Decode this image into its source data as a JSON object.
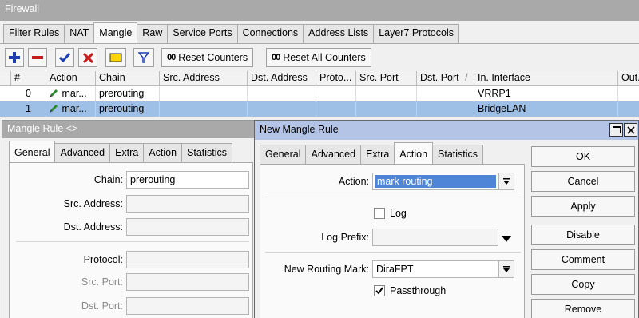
{
  "firewall": {
    "title": "Firewall",
    "tabs": [
      "Filter Rules",
      "NAT",
      "Mangle",
      "Raw",
      "Service Ports",
      "Connections",
      "Address Lists",
      "Layer7 Protocols"
    ],
    "active_tab": "Mangle",
    "toolbar": {
      "reset_counters": "Reset Counters",
      "reset_all_counters": "Reset All Counters",
      "counter_icon": "00"
    },
    "columns": [
      "#",
      "Action",
      "Chain",
      "Src. Address",
      "Dst. Address",
      "Proto...",
      "Src. Port",
      "Dst. Port",
      "In. Interface",
      "Out."
    ],
    "rows": [
      {
        "num": "0",
        "action": "mar...",
        "chain": "prerouting",
        "in_interface": "VRRP1"
      },
      {
        "num": "1",
        "action": "mar...",
        "chain": "prerouting",
        "in_interface": "BridgeLAN"
      }
    ]
  },
  "mangle_rule": {
    "title": "Mangle Rule <>",
    "tabs": [
      "General",
      "Advanced",
      "Extra",
      "Action",
      "Statistics"
    ],
    "active_tab": "General",
    "chain_label": "Chain:",
    "chain_value": "prerouting",
    "src_address_label": "Src. Address:",
    "dst_address_label": "Dst. Address:",
    "protocol_label": "Protocol:",
    "src_port_label": "Src. Port:",
    "dst_port_label": "Dst. Port:"
  },
  "new_mangle_rule": {
    "title": "New Mangle Rule",
    "tabs": [
      "General",
      "Advanced",
      "Extra",
      "Action",
      "Statistics"
    ],
    "active_tab": "Action",
    "action_label": "Action:",
    "action_value": "mark routing",
    "log_label": "Log",
    "log_checked": false,
    "log_prefix_label": "Log Prefix:",
    "routing_mark_label": "New Routing Mark:",
    "routing_mark_value": "DiraFPT",
    "passthrough_label": "Passthrough",
    "passthrough_checked": true,
    "buttons": [
      "OK",
      "Cancel",
      "Apply",
      "Disable",
      "Comment",
      "Copy",
      "Remove"
    ]
  },
  "colors": {
    "selection": "#9ebfe6",
    "active_title": "#b3c4e6",
    "inactive_title": "#a9a9a9",
    "highlight": "#4f85d6"
  }
}
